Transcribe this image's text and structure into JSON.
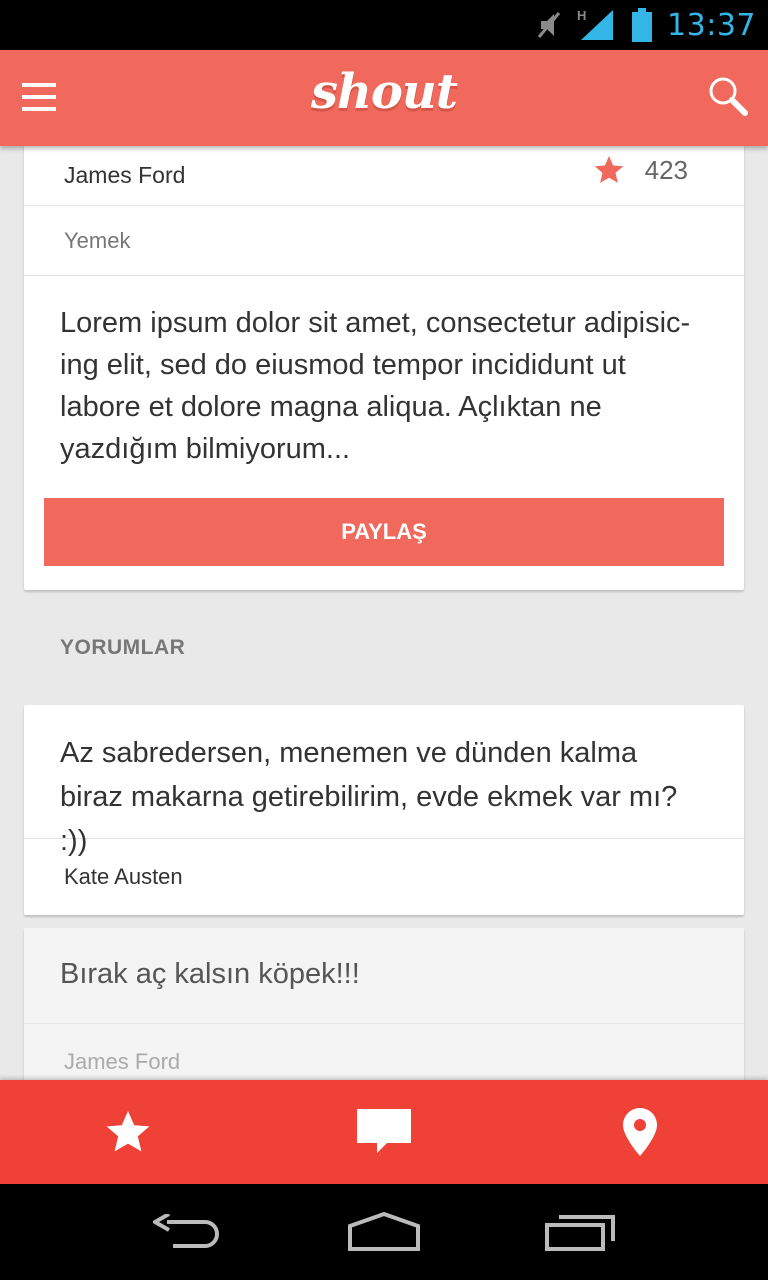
{
  "status_bar": {
    "time": "13:37",
    "network": "H",
    "icons": [
      "mute-icon",
      "signal-icon",
      "battery-icon"
    ],
    "color": "#33b5e5"
  },
  "app_bar": {
    "logo": "shout",
    "color": "#f0695c",
    "icons": [
      "menu-icon",
      "search-icon"
    ]
  },
  "post": {
    "author": "James Ford",
    "rating": "423",
    "category": "Yemek",
    "text": "Lorem ipsum dolor sit amet, consectetur adipisic-ing elit, sed do eiusmod tempor incididunt ut labore et dolore magna aliqua. Açlıktan ne yazdığım bilmiyorum...",
    "share_label": "PAYLAŞ",
    "star_color": "#f0695c"
  },
  "comments_section": {
    "title": "YORUMLAR"
  },
  "comments": [
    {
      "text": "Az sabredersen, menemen ve dünden kalma biraz makarna getirebilirim, evde ekmek var mı? :))",
      "author": "Kate Austen"
    },
    {
      "text": "Bırak aç kalsın köpek!!!",
      "author": "James Ford"
    }
  ],
  "tab_bar": {
    "color": "#ef4136",
    "tabs": [
      "star-icon",
      "chat-icon",
      "location-pin-icon"
    ]
  },
  "nav_bar": {
    "buttons": [
      "back-icon",
      "home-icon",
      "recents-icon"
    ]
  }
}
